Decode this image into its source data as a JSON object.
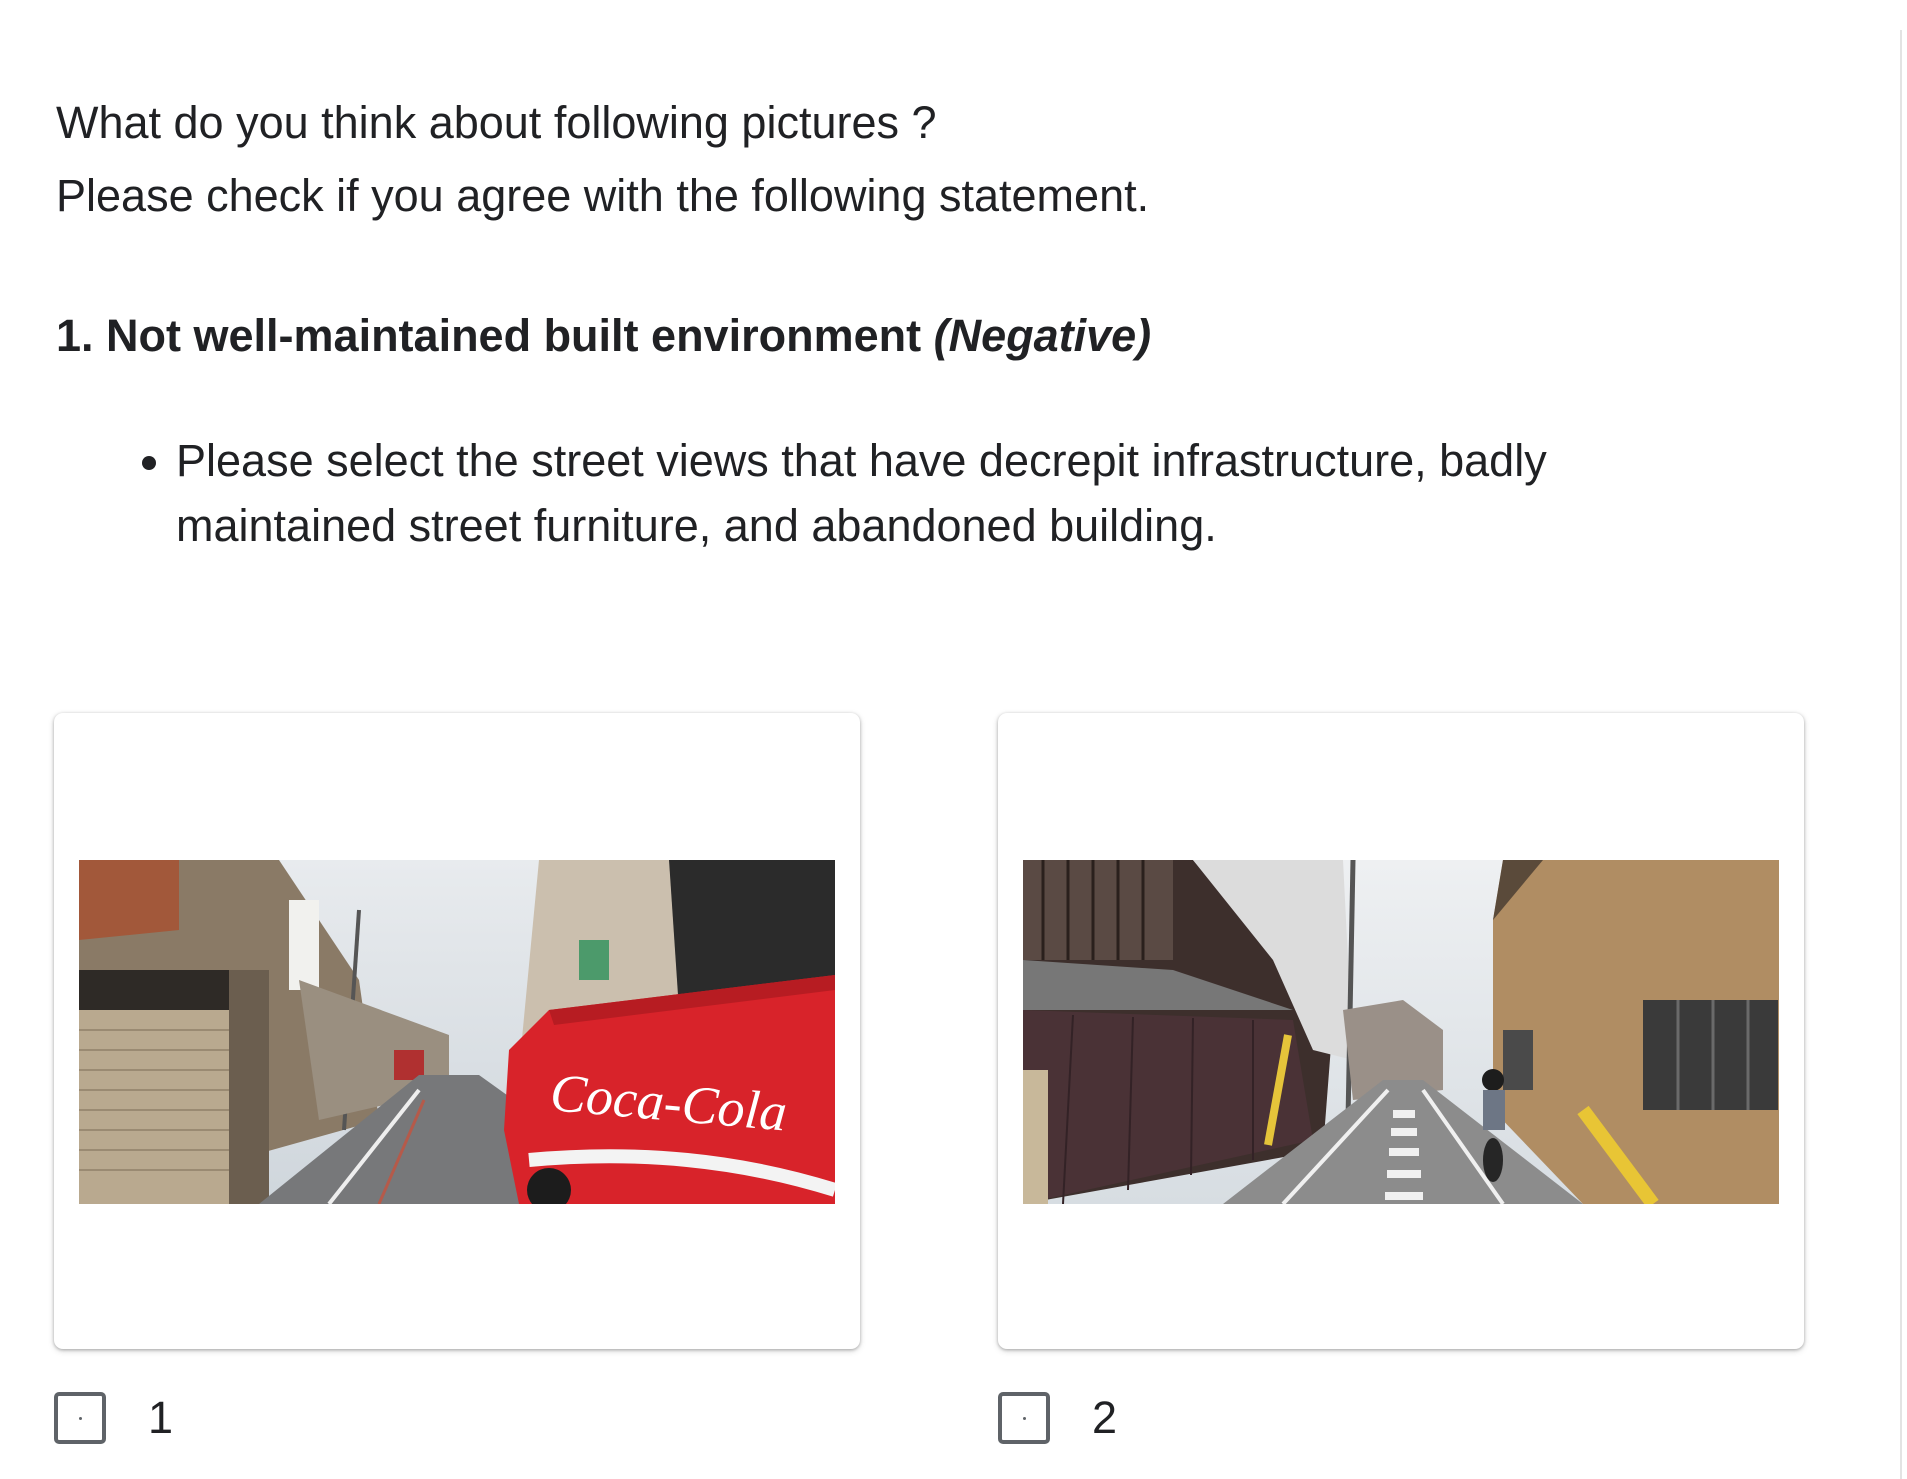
{
  "intro": {
    "line1": "What do you think about following pictures ?",
    "line2": "Please check if you agree with the following statement."
  },
  "question": {
    "title": "1. Not well-maintained built environment",
    "tag": "(Negative)",
    "instruction": "Please select the street views that have decrepit infrastructure, badly maintained street furniture, and abandoned building."
  },
  "options": [
    {
      "label": "1",
      "checked": false,
      "photo_text": "Coca-Cola"
    },
    {
      "label": "2",
      "checked": false
    }
  ],
  "colors": {
    "text": "#202124",
    "checkbox_border": "#5f6368",
    "truck_red": "#d8232a"
  }
}
